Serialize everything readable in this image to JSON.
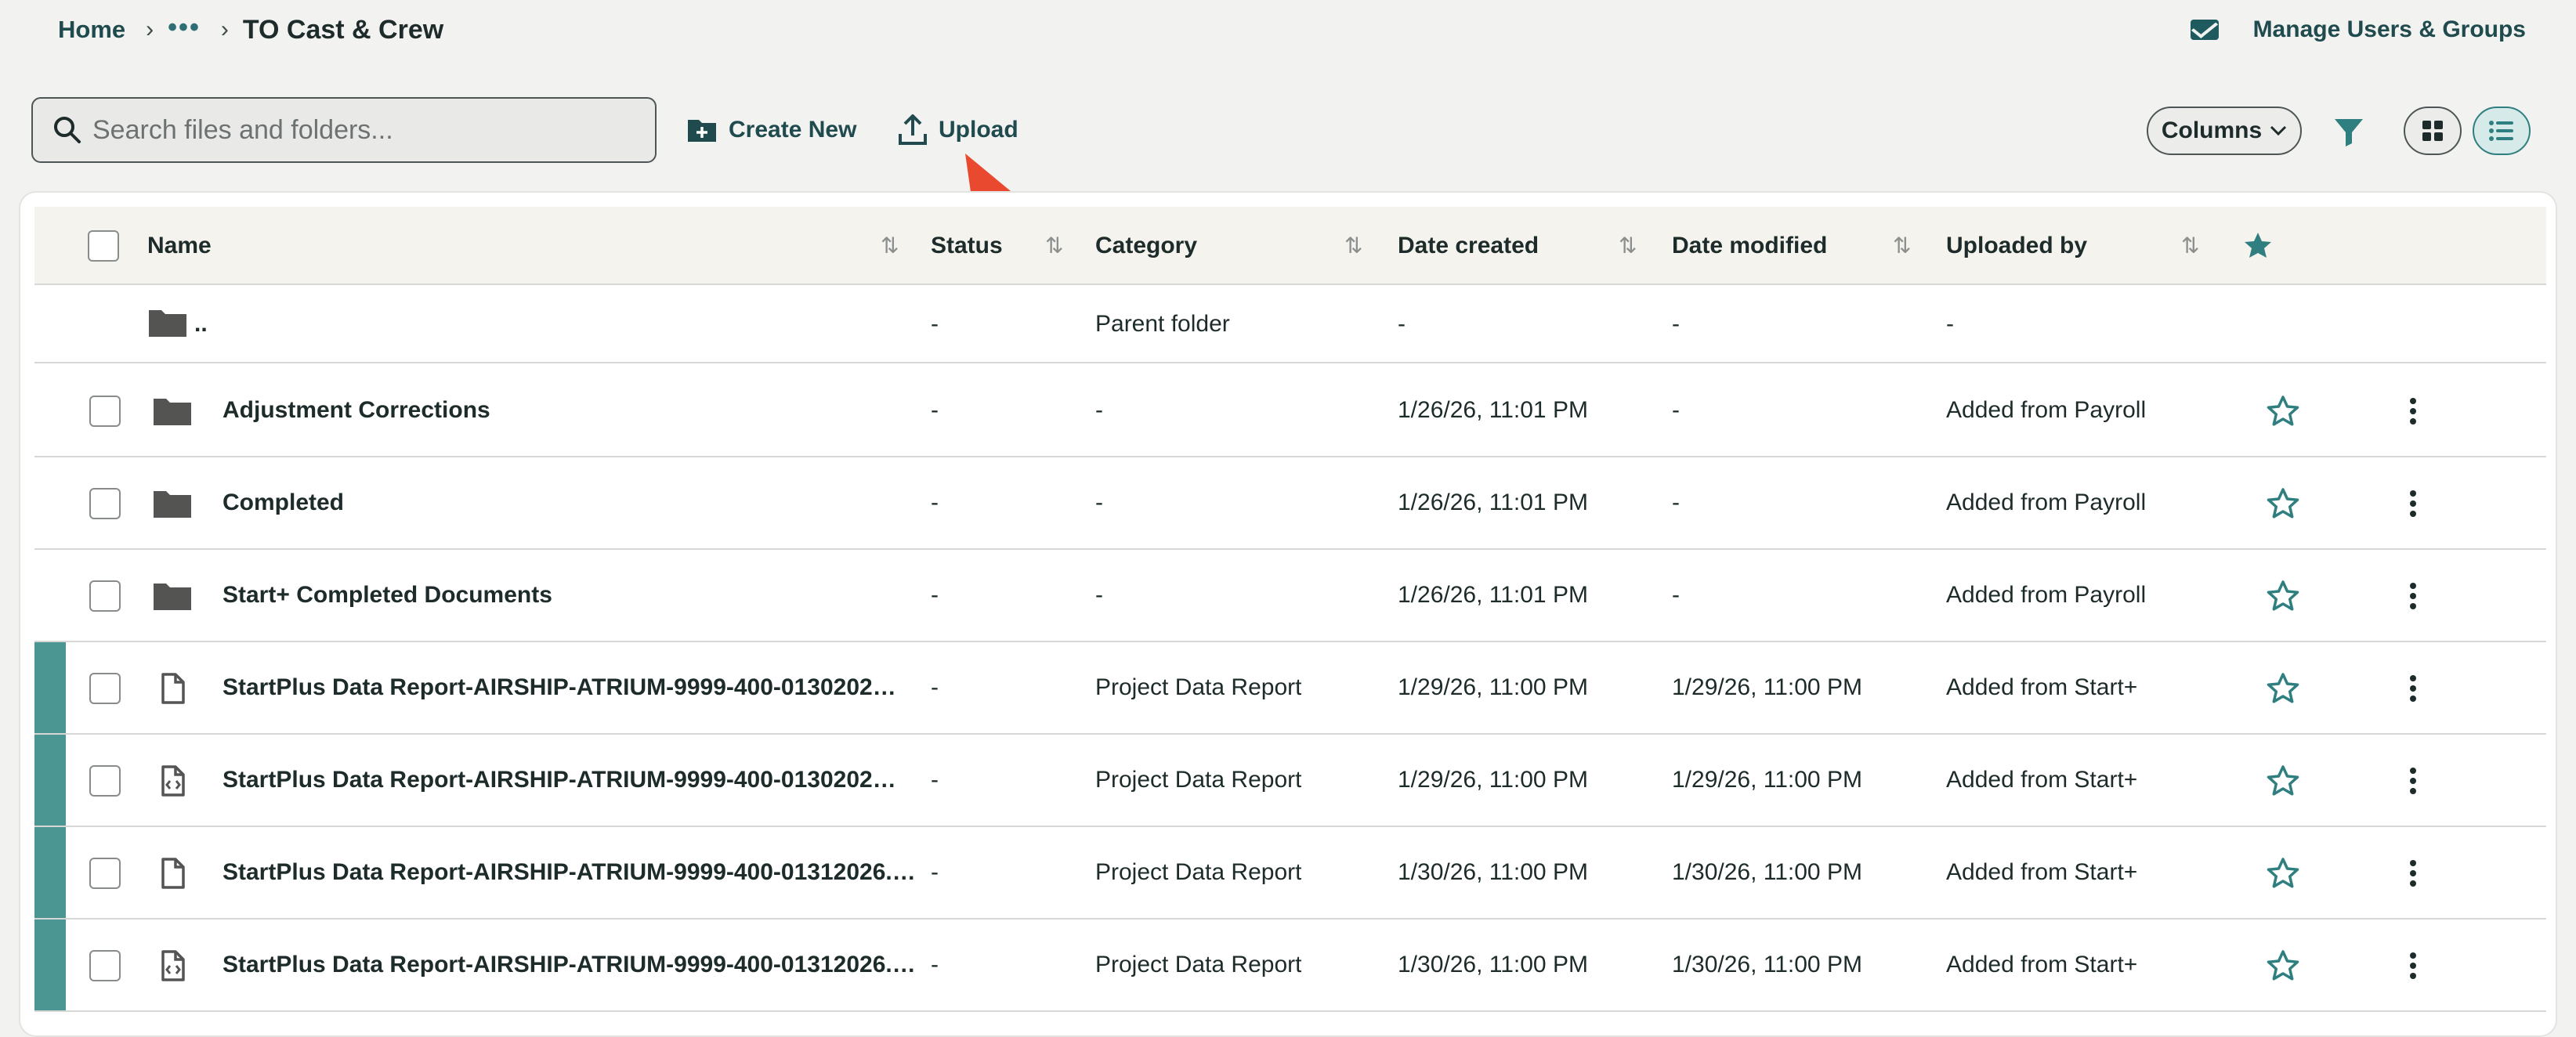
{
  "breadcrumb": {
    "home": "Home",
    "more": "•••",
    "current": "TO Cast & Crew"
  },
  "header": {
    "manage_users": "Manage Users & Groups"
  },
  "toolbar": {
    "search_placeholder": "Search files and folders...",
    "create_new": "Create New",
    "upload": "Upload",
    "columns": "Columns"
  },
  "colors": {
    "brand": "#1f4a4e",
    "accent": "#2f7f80",
    "marker": "#4b9592",
    "annotation_arrow": "#e8492f"
  },
  "table": {
    "headers": [
      "Name",
      "Status",
      "Category",
      "Date created",
      "Date modified",
      "Uploaded by"
    ],
    "parent": {
      "name": "..",
      "status": "-",
      "category": "Parent folder",
      "date_created": "-",
      "date_modified": "-",
      "uploaded_by": "-"
    },
    "rows": [
      {
        "name": "Adjustment Corrections",
        "icon": "folder-icon",
        "status": "-",
        "category": "-",
        "date_created": "1/26/26, 11:01 PM",
        "date_modified": "-",
        "uploaded_by": "Added from Payroll",
        "marked": false
      },
      {
        "name": "Completed",
        "icon": "folder-icon",
        "status": "-",
        "category": "-",
        "date_created": "1/26/26, 11:01 PM",
        "date_modified": "-",
        "uploaded_by": "Added from Payroll",
        "marked": false
      },
      {
        "name": "Start+ Completed Documents",
        "icon": "folder-icon",
        "status": "-",
        "category": "-",
        "date_created": "1/26/26, 11:01 PM",
        "date_modified": "-",
        "uploaded_by": "Added from Payroll",
        "marked": false
      },
      {
        "name": "StartPlus Data Report-AIRSHIP-ATRIUM-9999-400-0130202…",
        "icon": "file-icon",
        "status": "-",
        "category": "Project Data Report",
        "date_created": "1/29/26, 11:00 PM",
        "date_modified": "1/29/26, 11:00 PM",
        "uploaded_by": "Added from Start+",
        "marked": true
      },
      {
        "name": "StartPlus Data Report-AIRSHIP-ATRIUM-9999-400-0130202…",
        "icon": "code-file-icon",
        "status": "-",
        "category": "Project Data Report",
        "date_created": "1/29/26, 11:00 PM",
        "date_modified": "1/29/26, 11:00 PM",
        "uploaded_by": "Added from Start+",
        "marked": true
      },
      {
        "name": "StartPlus Data Report-AIRSHIP-ATRIUM-9999-400-01312026.…",
        "icon": "file-icon",
        "status": "-",
        "category": "Project Data Report",
        "date_created": "1/30/26, 11:00 PM",
        "date_modified": "1/30/26, 11:00 PM",
        "uploaded_by": "Added from Start+",
        "marked": true
      },
      {
        "name": "StartPlus Data Report-AIRSHIP-ATRIUM-9999-400-01312026.…",
        "icon": "code-file-icon",
        "status": "-",
        "category": "Project Data Report",
        "date_created": "1/30/26, 11:00 PM",
        "date_modified": "1/30/26, 11:00 PM",
        "uploaded_by": "Added from Start+",
        "marked": true
      }
    ]
  }
}
